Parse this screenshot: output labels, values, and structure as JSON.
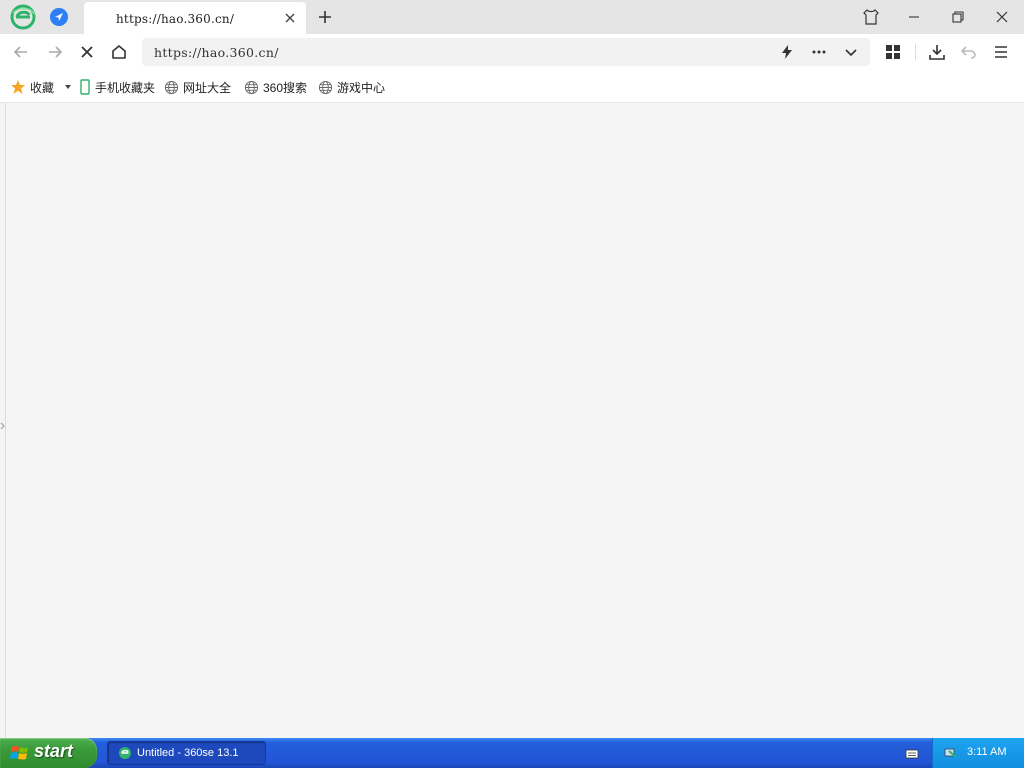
{
  "browser": {
    "tab": {
      "title": "https://hao.360.cn/"
    },
    "address_bar": {
      "url": "https://hao.360.cn/"
    }
  },
  "bookmarks": {
    "favorites_label": "收藏",
    "items": [
      {
        "label": "手机收藏夹",
        "icon": "phone-icon"
      },
      {
        "label": "网址大全",
        "icon": "globe-icon"
      },
      {
        "label": "360搜索",
        "icon": "globe-icon"
      },
      {
        "label": "游戏中心",
        "icon": "globe-icon"
      }
    ]
  },
  "taskbar": {
    "start_label": "start",
    "task_label": "Untitled - 360se 13.1",
    "clock": "3:11 AM"
  },
  "colors": {
    "accent_green": "#3cb371",
    "accent_blue": "#2e7ff5",
    "taskbar_blue": "#2256d6",
    "start_green": "#3a9a3a"
  }
}
